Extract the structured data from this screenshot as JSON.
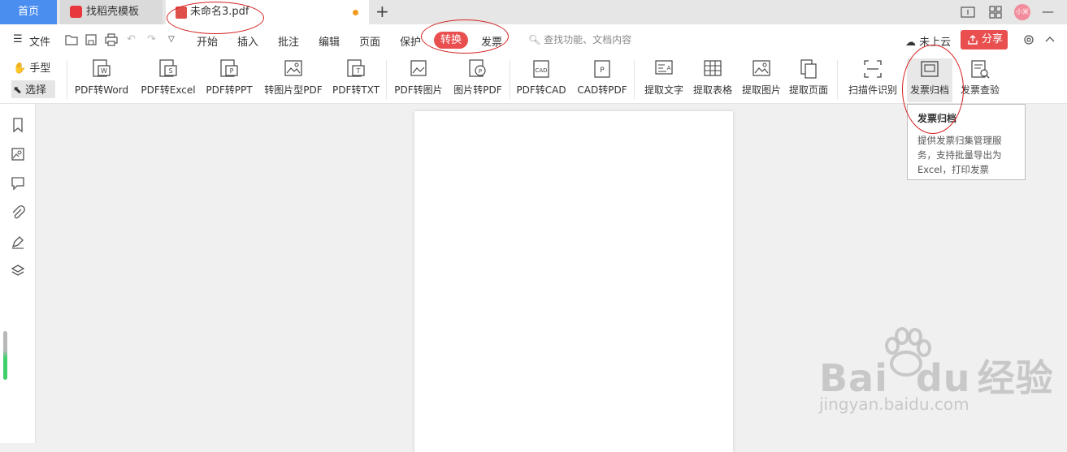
{
  "tabs": {
    "home": "首页",
    "template": "找稻壳模板",
    "document": "未命名3.pdf",
    "add": "+"
  },
  "window": {
    "avatar_text": "小米"
  },
  "menu": {
    "file": "文件",
    "items": [
      "开始",
      "插入",
      "批注",
      "编辑",
      "页面",
      "保护"
    ],
    "active": "转换",
    "after_active": "发票",
    "search_placeholder": "查找功能、文档内容",
    "cloud": "未上云",
    "share": "分享"
  },
  "ribbon": {
    "hand": "手型",
    "select": "选择",
    "buttons": [
      "PDF转Word",
      "PDF转Excel",
      "PDF转PPT",
      "转图片型PDF",
      "PDF转TXT",
      "PDF转图片",
      "图片转PDF",
      "PDF转CAD",
      "CAD转PDF",
      "提取文字",
      "提取表格",
      "提取图片",
      "提取页面",
      "扫描件识别",
      "发票归档",
      "发票查验"
    ]
  },
  "tooltip": {
    "title": "发票归档",
    "desc_lines": [
      "提供发票归集管理服",
      "务，支持批量导出为",
      "Excel，打印发票"
    ]
  },
  "watermark": {
    "logo": "Bai",
    "logo2": "du",
    "cn": "经验",
    "url": "jingyan.baidu.com"
  },
  "colors": {
    "accent_red": "#e94f4f",
    "home_tab_blue": "#4a8ef0",
    "annotation": "#d42020"
  },
  "icons": [
    "bookmark-icon",
    "thumbnail-icon",
    "comment-icon",
    "attachment-icon",
    "signature-icon",
    "layers-icon"
  ]
}
